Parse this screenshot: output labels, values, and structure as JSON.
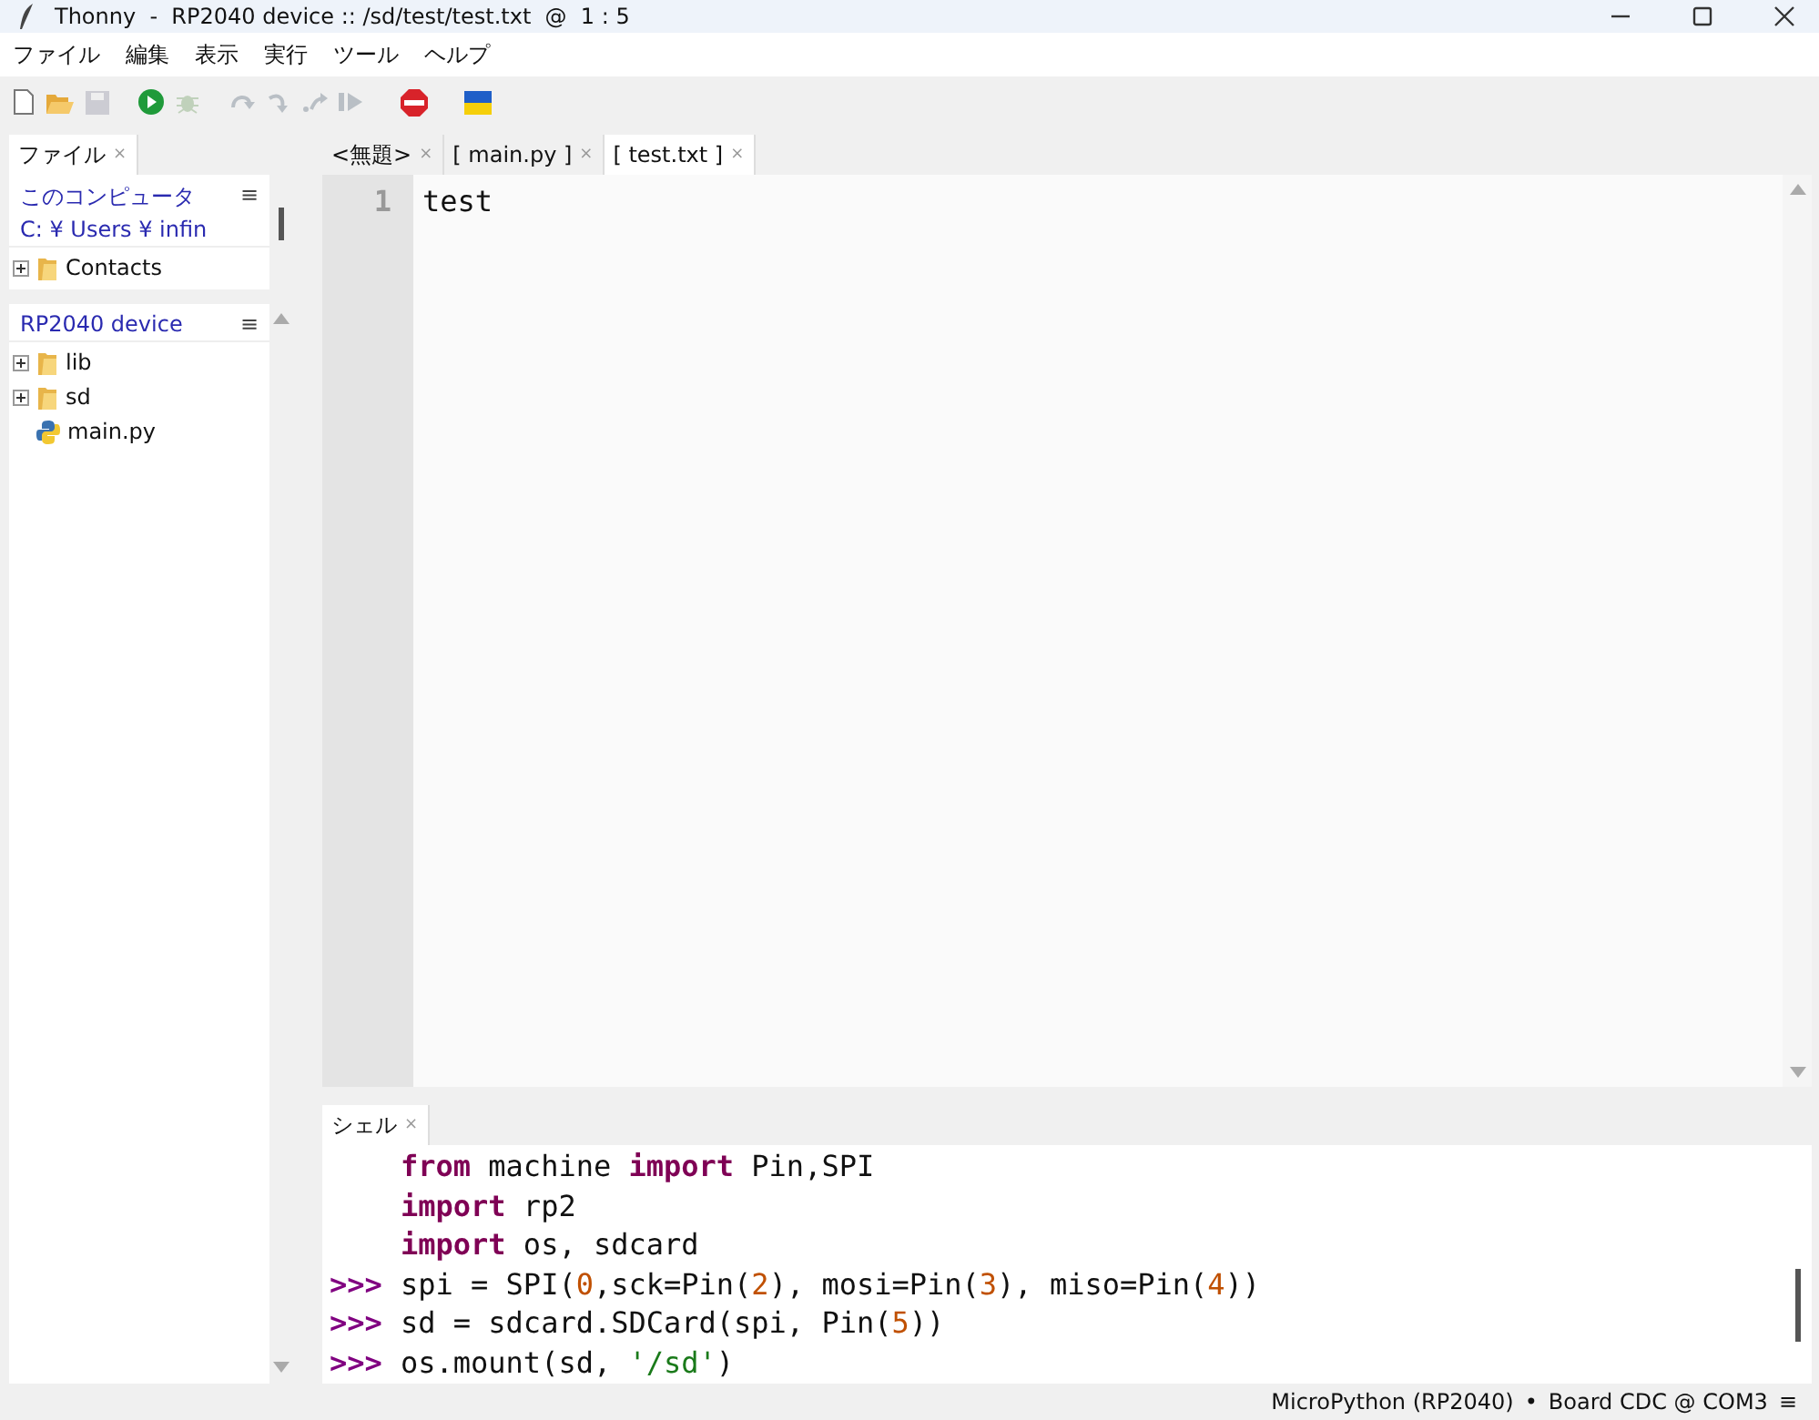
{
  "window": {
    "title": "Thonny  -  RP2040 device :: /sd/test/test.txt  @  1 : 5"
  },
  "menu": [
    "ファイル",
    "編集",
    "表示",
    "実行",
    "ツール",
    "ヘルプ"
  ],
  "toolbar": [
    {
      "kind": "new",
      "disabled": false
    },
    {
      "kind": "open",
      "disabled": false
    },
    {
      "kind": "save",
      "disabled": true
    },
    {
      "kind": "run",
      "disabled": false
    },
    {
      "kind": "debug",
      "disabled": true
    },
    {
      "kind": "step-over",
      "disabled": true
    },
    {
      "kind": "step-into",
      "disabled": true
    },
    {
      "kind": "step-out",
      "disabled": true
    },
    {
      "kind": "resume",
      "disabled": true
    },
    {
      "kind": "stop",
      "disabled": false
    },
    {
      "kind": "flag",
      "disabled": false
    }
  ],
  "files_panel": {
    "tab": "ファイル",
    "close": "×",
    "sections": [
      {
        "title": "このコンピュータ",
        "path": "C: ¥ Users ¥ infin",
        "menu": "≡",
        "items": [
          {
            "name": "Contacts",
            "kind": "folder",
            "expanded": false
          }
        ]
      },
      {
        "title": "RP2040 device",
        "menu": "≡",
        "items": [
          {
            "name": "lib",
            "kind": "folder",
            "expanded": false
          },
          {
            "name": "sd",
            "kind": "folder",
            "expanded": false
          },
          {
            "name": "main.py",
            "kind": "python"
          }
        ]
      }
    ]
  },
  "editor": {
    "tabs": [
      {
        "label": "<無題>",
        "close": "×",
        "selected": false
      },
      {
        "label": "[ main.py ]",
        "close": "×",
        "selected": false
      },
      {
        "label": "[ test.txt ]",
        "close": "×",
        "selected": true
      }
    ],
    "lines": [
      {
        "number": "1",
        "text": "test"
      }
    ]
  },
  "shell": {
    "tab": "シェル",
    "close": "×",
    "lines": [
      {
        "tokens": [
          {
            "text": "from",
            "kind": "keyword"
          },
          {
            "text": " machine ",
            "kind": "plain"
          },
          {
            "text": "import",
            "kind": "keyword"
          },
          {
            "text": " Pin,SPI",
            "kind": "plain"
          }
        ]
      },
      {
        "tokens": [
          {
            "text": "import",
            "kind": "keyword"
          },
          {
            "text": " rp2",
            "kind": "plain"
          }
        ]
      },
      {
        "tokens": [
          {
            "text": "import",
            "kind": "keyword"
          },
          {
            "text": " os, sdcard",
            "kind": "plain"
          }
        ]
      },
      {
        "prompt": ">>>",
        "tokens": [
          {
            "text": "spi = SPI(",
            "kind": "plain"
          },
          {
            "text": "0",
            "kind": "number"
          },
          {
            "text": ",sck=Pin(",
            "kind": "plain"
          },
          {
            "text": "2",
            "kind": "number"
          },
          {
            "text": "), mosi=Pin(",
            "kind": "plain"
          },
          {
            "text": "3",
            "kind": "number"
          },
          {
            "text": "), miso=Pin(",
            "kind": "plain"
          },
          {
            "text": "4",
            "kind": "number"
          },
          {
            "text": "))",
            "kind": "plain"
          }
        ]
      },
      {
        "prompt": ">>>",
        "tokens": [
          {
            "text": "sd = sdcard.SDCard(spi, Pin(",
            "kind": "plain"
          },
          {
            "text": "5",
            "kind": "number"
          },
          {
            "text": "))",
            "kind": "plain"
          }
        ]
      },
      {
        "prompt": ">>>",
        "tokens": [
          {
            "text": "os.mount(sd, ",
            "kind": "plain"
          },
          {
            "text": "'/sd'",
            "kind": "string"
          },
          {
            "text": ")",
            "kind": "plain"
          }
        ]
      }
    ]
  },
  "status_bar": {
    "interpreter": "MicroPython (RP2040)",
    "separator": "•",
    "port": "Board CDC @ COM3",
    "menu": "≡"
  }
}
